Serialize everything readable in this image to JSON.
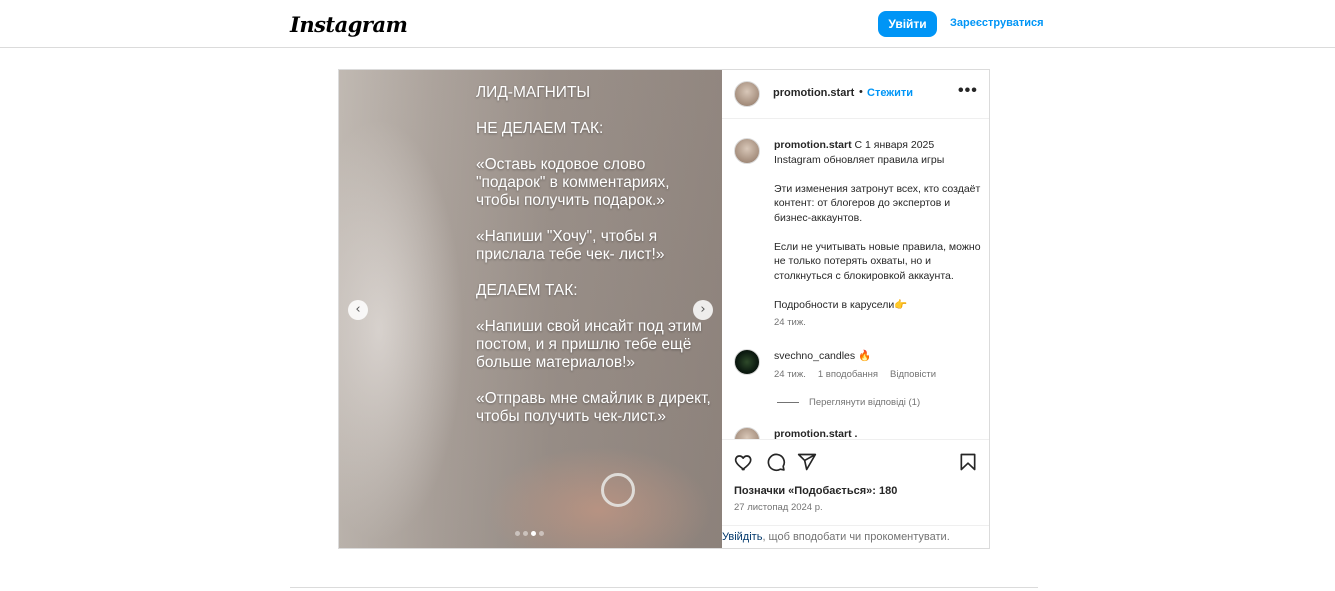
{
  "header": {
    "logo": "Instagram",
    "login_label": "Увійти",
    "signup_label": "Зареєструватися"
  },
  "colors": {
    "accent": "#0095f6",
    "border": "#dbdbdb",
    "muted_text": "#737373"
  },
  "post": {
    "username": "promotion.start",
    "bullet": "•",
    "follow_label": "Стежити",
    "more_icon": "more-horizontal-icon",
    "carousel": {
      "slide_count": 4,
      "active_index": 2,
      "text_lines": [
        "ЛИД-МАГНИТЫ",
        "НЕ ДЕЛАЕМ ТАК:",
        "«Оставь кодовое слово \"подарок\" в комментариях, чтобы получить подарок.»",
        "«Напиши \"Хочу\", чтобы я прислала тебе чек- лист!»",
        "ДЕЛАЕМ ТАК:",
        "«Напиши свой инсайт под этим постом, и я пришлю тебе ещё больше материалов!»",
        "«Отправь мне смайлик в директ, чтобы получить чек-лист.»"
      ],
      "prev_icon": "chevron-left-icon",
      "next_icon": "chevron-right-icon"
    },
    "caption": {
      "username": "promotion.start",
      "line1": " С 1 января 2025",
      "line2": "Instagram обновляет правила игры",
      "para2": "Эти изменения затронут всех, кто создаёт контент: от блогеров до экспертов и бизнес-аккаунтов.",
      "para3": "Если не учитывать новые правила, можно не только потерять охваты, но и столкнуться с блокировкой аккаунта.",
      "para4": "Подробности в карусели👉",
      "time": "24 тиж."
    },
    "comments": [
      {
        "username": "svechno_candles",
        "text": " 🔥",
        "time": "24 тиж.",
        "likes": "1 вподобання",
        "reply_label": "Відповісти",
        "view_replies": "Переглянути відповіді (1)"
      },
      {
        "username": "promotion.start",
        "text": " ."
      }
    ],
    "likes_text": "Позначки «Подобається»: 180",
    "date": "27 листопад 2024 р.",
    "login_prompt": {
      "link": "Увійдіть",
      "rest": ", щоб вподобати чи прокоментувати."
    }
  }
}
